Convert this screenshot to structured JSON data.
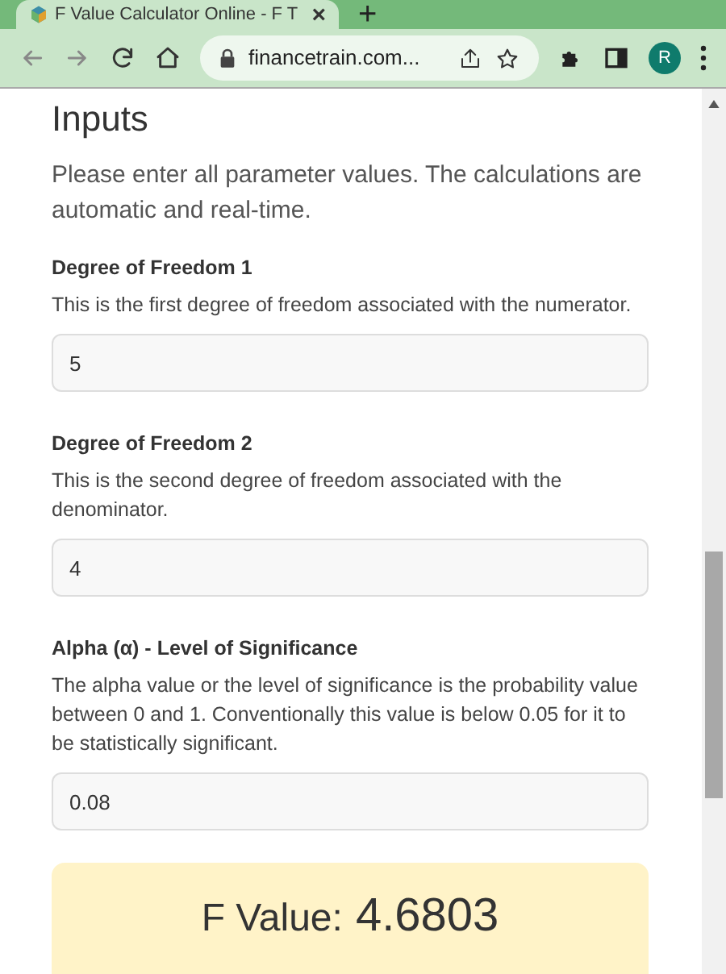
{
  "browser": {
    "tab_title": "F Value Calculator Online - F T",
    "tab_close": "×",
    "new_tab": "+",
    "url": "financetrain.com...",
    "profile_initial": "R"
  },
  "page": {
    "heading": "Inputs",
    "intro": "Please enter all parameter values. The calculations are automatic and real-time.",
    "fields": [
      {
        "label": "Degree of Freedom 1",
        "description": "This is the first degree of freedom associated with the numerator.",
        "value": "5"
      },
      {
        "label": "Degree of Freedom 2",
        "description": "This is the second degree of freedom associated with the denominator.",
        "value": "4"
      },
      {
        "label": "Alpha (α) - Level of Significance",
        "description": "The alpha value or the level of significance is the probability value between 0 and 1. Conventionally this value is below 0.05 for it to be statistically significant.",
        "value": "0.08"
      }
    ],
    "result": {
      "label": "F Value:",
      "value": "4.6803"
    }
  }
}
